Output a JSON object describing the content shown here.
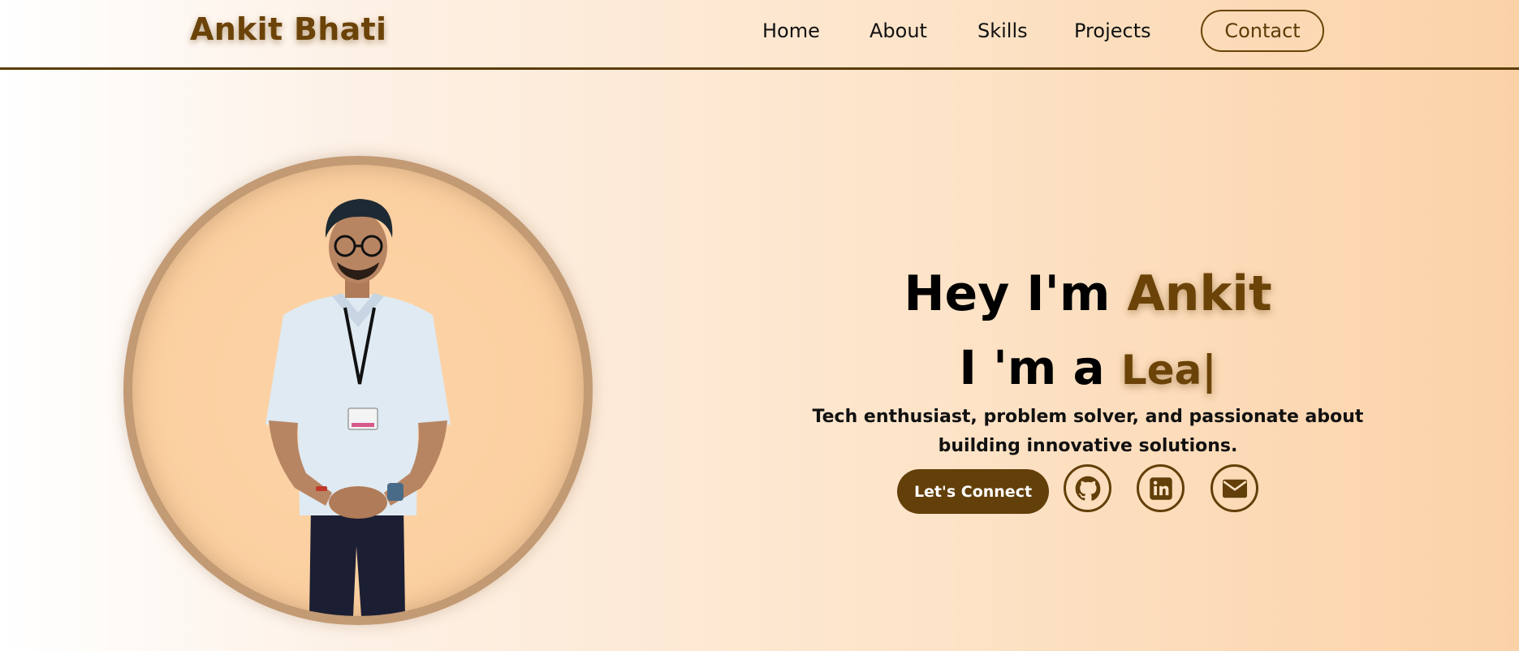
{
  "navbar": {
    "brand": "Ankit Bhati",
    "links": [
      "Home",
      "About",
      "Skills",
      "Projects"
    ],
    "contact_label": "Contact"
  },
  "hero": {
    "greeting_prefix": "Hey I'm ",
    "greeting_name": "Ankit",
    "role_prefix": "I 'm a ",
    "role_typed": "Lea|",
    "tagline_line1": "Tech enthusiast, problem solver, and passionate about",
    "tagline_line2": "building innovative solutions.",
    "connect_label": "Let's Connect",
    "social_icons": [
      "github-icon",
      "linkedin-icon",
      "mail-icon"
    ]
  },
  "colors": {
    "accent": "#6b4308",
    "button": "#633f09",
    "ring": "#c29a74"
  }
}
